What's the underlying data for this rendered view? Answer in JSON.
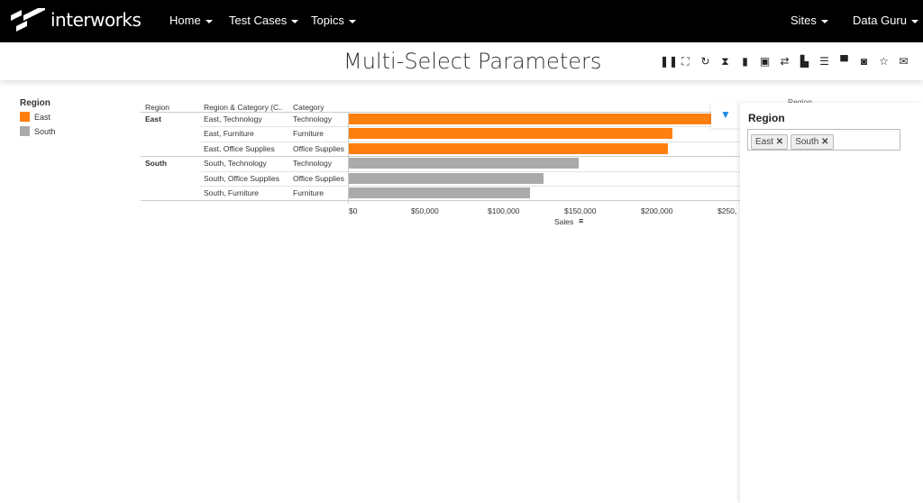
{
  "nav": {
    "brand": "interworks",
    "items": [
      "Home",
      "Test Cases",
      "Topics"
    ],
    "right": [
      "Sites",
      "Data Guru"
    ]
  },
  "title": "Multi-Select Parameters",
  "toolbar": [
    "pause-icon",
    "fullscreen-icon",
    "refresh-icon",
    "hourglass-icon",
    "file-icon",
    "image-icon",
    "swap-icon",
    "save-icon",
    "list-icon",
    "presentation-icon",
    "camera-icon",
    "star-icon",
    "email-icon"
  ],
  "legend": {
    "title": "Region",
    "items": [
      {
        "label": "East",
        "color": "#ff7f0e"
      },
      {
        "label": "South",
        "color": "#aaaaaa"
      }
    ]
  },
  "table": {
    "headers": [
      "Region",
      "Region & Category (C..",
      "Category"
    ],
    "groups": [
      "East",
      "South"
    ]
  },
  "chart_data": {
    "type": "bar",
    "orientation": "horizontal",
    "rows": [
      {
        "region": "East",
        "label": "East, Technology",
        "category": "Technology",
        "value": 265000
      },
      {
        "region": "East",
        "label": "East, Furniture",
        "category": "Furniture",
        "value": 211000
      },
      {
        "region": "East",
        "label": "East, Office Supplies",
        "category": "Office Supplies",
        "value": 208000
      },
      {
        "region": "South",
        "label": "South, Technology",
        "category": "Technology",
        "value": 150000
      },
      {
        "region": "South",
        "label": "South, Office Supplies",
        "category": "Office Supplies",
        "value": 127000
      },
      {
        "region": "South",
        "label": "South, Furniture",
        "category": "Furniture",
        "value": 118000
      }
    ],
    "xlabel": "Sales",
    "ticks": [
      "$0",
      "$50,000",
      "$100,000",
      "$150,000",
      "$200,000",
      "$250,"
    ],
    "colors": {
      "East": "#ff7f0e",
      "South": "#aaaaaa"
    }
  },
  "filter": {
    "behind_label": "Region",
    "title": "Region",
    "selected": [
      "East",
      "South"
    ]
  }
}
